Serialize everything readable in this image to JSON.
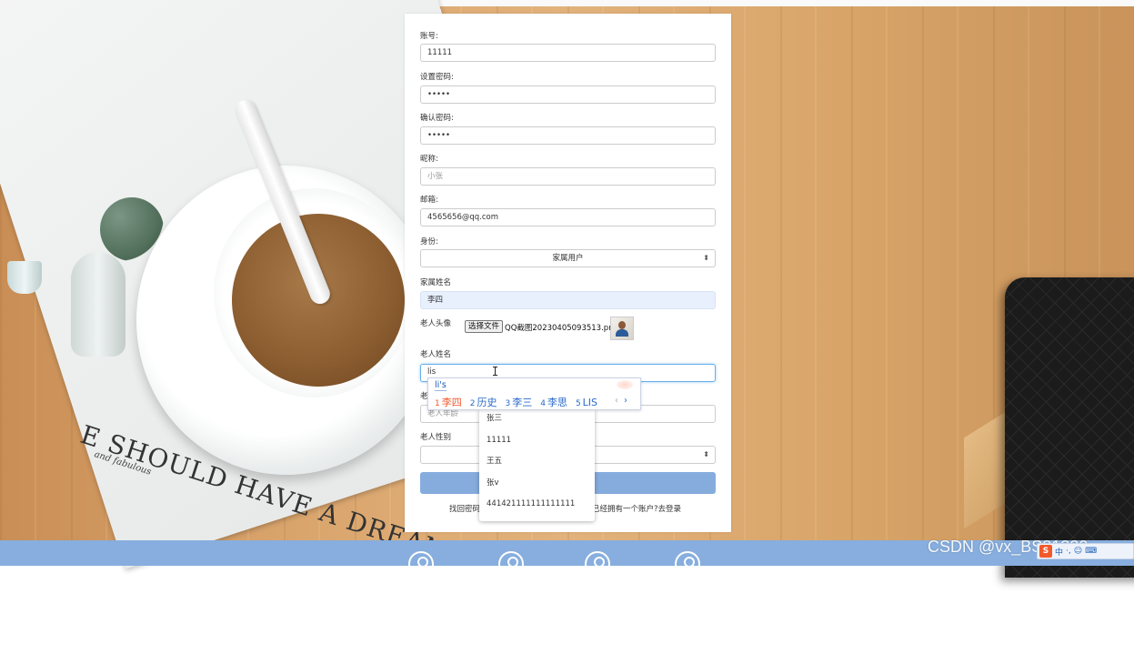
{
  "form": {
    "account": {
      "label": "账号:",
      "value": "11111"
    },
    "password": {
      "label": "设置密码:",
      "value": "•••••"
    },
    "confirm_password": {
      "label": "确认密码:",
      "value": "•••••"
    },
    "nickname": {
      "label": "昵称:",
      "placeholder": "小张"
    },
    "email": {
      "label": "邮箱:",
      "value": "4565656@qq.com"
    },
    "role": {
      "label": "身份:",
      "selected": "家属用户"
    },
    "family_name": {
      "label": "家属姓名",
      "value": "李四"
    },
    "elder_avatar": {
      "label": "老人头像",
      "button": "选择文件",
      "filename": "QQ截图20230405093513.png"
    },
    "elder_name": {
      "label": "老人姓名",
      "value": "lis"
    },
    "elder_age": {
      "label": "老",
      "placeholder": "老人年龄"
    },
    "elder_gender": {
      "label": "老人性别"
    },
    "links": {
      "find_password": "找回密码",
      "has_account": "已经拥有一个账户?去登录"
    }
  },
  "autocomplete": {
    "items": [
      "张三",
      "11111",
      "王五",
      "张v",
      "441421111111111111"
    ]
  },
  "ime": {
    "composition": "li's",
    "candidates": [
      {
        "num": "1",
        "text": "李四"
      },
      {
        "num": "2",
        "text": "历史"
      },
      {
        "num": "3",
        "text": "李三"
      },
      {
        "num": "4",
        "text": "李思"
      },
      {
        "num": "5",
        "text": "LIS"
      }
    ],
    "prev": "‹",
    "next": "›"
  },
  "watermark": {
    "text": "CSDN @vx_BS81330"
  },
  "ime_toolbar": {
    "logo": "S",
    "items": [
      "中",
      "·,",
      "☺",
      "⌨"
    ]
  },
  "colors": {
    "submit": "#85acdd",
    "bottom_bar": "#87aede",
    "focus": "#66afe9",
    "candidate_selected": "#f0562b",
    "candidate": "#2a6ac8"
  }
}
